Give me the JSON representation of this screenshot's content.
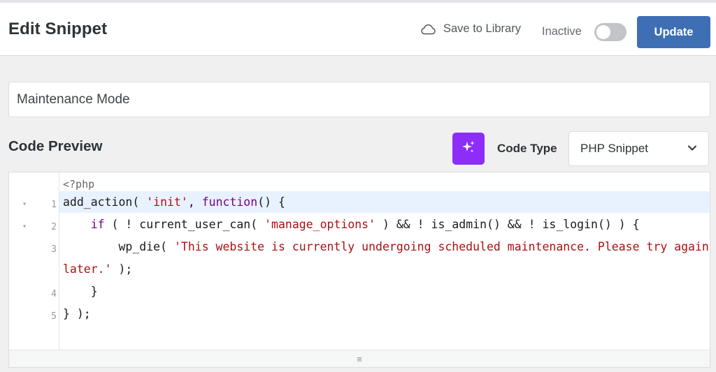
{
  "header": {
    "title": "Edit Snippet",
    "save_to_library": "Save to Library",
    "status": "Inactive",
    "update_label": "Update"
  },
  "snippet": {
    "title_value": "Maintenance Mode"
  },
  "code_preview": {
    "heading": "Code Preview",
    "code_type_label": "Code Type",
    "code_type_value": "PHP Snippet",
    "php_open": "<?php",
    "lines": [
      {
        "num": "1",
        "foldable": true
      },
      {
        "num": "2",
        "foldable": true
      },
      {
        "num": "3",
        "foldable": false
      },
      {
        "num": "4",
        "foldable": false
      },
      {
        "num": "5",
        "foldable": false
      }
    ],
    "code": {
      "l1_a": "add_action( ",
      "l1_b": "'init'",
      "l1_c": ", ",
      "l1_d": "function",
      "l1_e": "() {",
      "l2_a": "    ",
      "l2_b": "if",
      "l2_c": " ( ! current_user_can( ",
      "l2_d": "'manage_options'",
      "l2_e": " ) && ! is_admin() && ! is_login() ) {",
      "l3_a": "        wp_die( ",
      "l3_b": "'This website is currently undergoing scheduled maintenance. Please try again",
      "l3w_a": "later.'",
      "l3w_b": " );",
      "l4": "    }",
      "l5": "} );"
    },
    "resize_handle": "≡"
  },
  "colors": {
    "accent": "#3e6fb5",
    "ai_button": "#8c2dfa",
    "active_line": "#e8f2ff",
    "keyword": "#770088",
    "string": "#aa1111"
  },
  "icons": {
    "save": "cloud-icon",
    "ai": "sparkles-icon",
    "select": "chevron-down-icon",
    "fold": "fold-triangle-icon",
    "resize": "resize-handle-icon"
  },
  "toggle": {
    "active": false
  }
}
